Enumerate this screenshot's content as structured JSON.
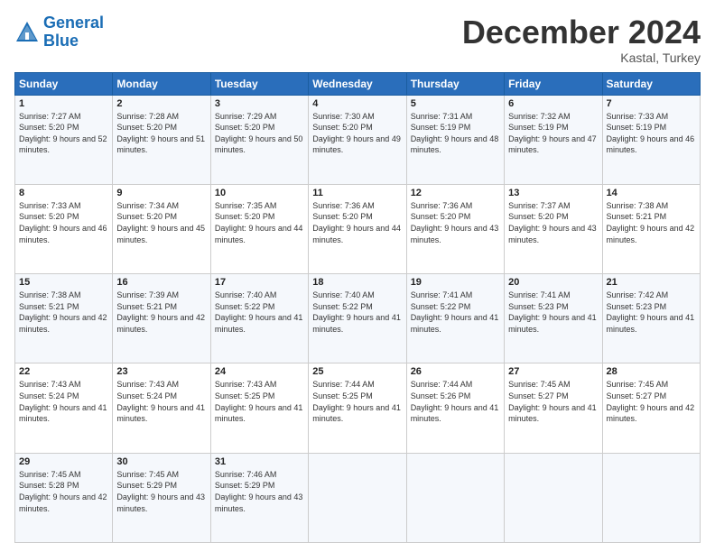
{
  "header": {
    "logo_line1": "General",
    "logo_line2": "Blue",
    "month_title": "December 2024",
    "subtitle": "Kastal, Turkey"
  },
  "weekdays": [
    "Sunday",
    "Monday",
    "Tuesday",
    "Wednesday",
    "Thursday",
    "Friday",
    "Saturday"
  ],
  "weeks": [
    [
      {
        "day": "1",
        "sunrise": "7:27 AM",
        "sunset": "5:20 PM",
        "daylight": "9 hours and 52 minutes."
      },
      {
        "day": "2",
        "sunrise": "7:28 AM",
        "sunset": "5:20 PM",
        "daylight": "9 hours and 51 minutes."
      },
      {
        "day": "3",
        "sunrise": "7:29 AM",
        "sunset": "5:20 PM",
        "daylight": "9 hours and 50 minutes."
      },
      {
        "day": "4",
        "sunrise": "7:30 AM",
        "sunset": "5:20 PM",
        "daylight": "9 hours and 49 minutes."
      },
      {
        "day": "5",
        "sunrise": "7:31 AM",
        "sunset": "5:19 PM",
        "daylight": "9 hours and 48 minutes."
      },
      {
        "day": "6",
        "sunrise": "7:32 AM",
        "sunset": "5:19 PM",
        "daylight": "9 hours and 47 minutes."
      },
      {
        "day": "7",
        "sunrise": "7:33 AM",
        "sunset": "5:19 PM",
        "daylight": "9 hours and 46 minutes."
      }
    ],
    [
      {
        "day": "8",
        "sunrise": "7:33 AM",
        "sunset": "5:20 PM",
        "daylight": "9 hours and 46 minutes."
      },
      {
        "day": "9",
        "sunrise": "7:34 AM",
        "sunset": "5:20 PM",
        "daylight": "9 hours and 45 minutes."
      },
      {
        "day": "10",
        "sunrise": "7:35 AM",
        "sunset": "5:20 PM",
        "daylight": "9 hours and 44 minutes."
      },
      {
        "day": "11",
        "sunrise": "7:36 AM",
        "sunset": "5:20 PM",
        "daylight": "9 hours and 44 minutes."
      },
      {
        "day": "12",
        "sunrise": "7:36 AM",
        "sunset": "5:20 PM",
        "daylight": "9 hours and 43 minutes."
      },
      {
        "day": "13",
        "sunrise": "7:37 AM",
        "sunset": "5:20 PM",
        "daylight": "9 hours and 43 minutes."
      },
      {
        "day": "14",
        "sunrise": "7:38 AM",
        "sunset": "5:21 PM",
        "daylight": "9 hours and 42 minutes."
      }
    ],
    [
      {
        "day": "15",
        "sunrise": "7:38 AM",
        "sunset": "5:21 PM",
        "daylight": "9 hours and 42 minutes."
      },
      {
        "day": "16",
        "sunrise": "7:39 AM",
        "sunset": "5:21 PM",
        "daylight": "9 hours and 42 minutes."
      },
      {
        "day": "17",
        "sunrise": "7:40 AM",
        "sunset": "5:22 PM",
        "daylight": "9 hours and 41 minutes."
      },
      {
        "day": "18",
        "sunrise": "7:40 AM",
        "sunset": "5:22 PM",
        "daylight": "9 hours and 41 minutes."
      },
      {
        "day": "19",
        "sunrise": "7:41 AM",
        "sunset": "5:22 PM",
        "daylight": "9 hours and 41 minutes."
      },
      {
        "day": "20",
        "sunrise": "7:41 AM",
        "sunset": "5:23 PM",
        "daylight": "9 hours and 41 minutes."
      },
      {
        "day": "21",
        "sunrise": "7:42 AM",
        "sunset": "5:23 PM",
        "daylight": "9 hours and 41 minutes."
      }
    ],
    [
      {
        "day": "22",
        "sunrise": "7:43 AM",
        "sunset": "5:24 PM",
        "daylight": "9 hours and 41 minutes."
      },
      {
        "day": "23",
        "sunrise": "7:43 AM",
        "sunset": "5:24 PM",
        "daylight": "9 hours and 41 minutes."
      },
      {
        "day": "24",
        "sunrise": "7:43 AM",
        "sunset": "5:25 PM",
        "daylight": "9 hours and 41 minutes."
      },
      {
        "day": "25",
        "sunrise": "7:44 AM",
        "sunset": "5:25 PM",
        "daylight": "9 hours and 41 minutes."
      },
      {
        "day": "26",
        "sunrise": "7:44 AM",
        "sunset": "5:26 PM",
        "daylight": "9 hours and 41 minutes."
      },
      {
        "day": "27",
        "sunrise": "7:45 AM",
        "sunset": "5:27 PM",
        "daylight": "9 hours and 41 minutes."
      },
      {
        "day": "28",
        "sunrise": "7:45 AM",
        "sunset": "5:27 PM",
        "daylight": "9 hours and 42 minutes."
      }
    ],
    [
      {
        "day": "29",
        "sunrise": "7:45 AM",
        "sunset": "5:28 PM",
        "daylight": "9 hours and 42 minutes."
      },
      {
        "day": "30",
        "sunrise": "7:45 AM",
        "sunset": "5:29 PM",
        "daylight": "9 hours and 43 minutes."
      },
      {
        "day": "31",
        "sunrise": "7:46 AM",
        "sunset": "5:29 PM",
        "daylight": "9 hours and 43 minutes."
      },
      null,
      null,
      null,
      null
    ]
  ]
}
